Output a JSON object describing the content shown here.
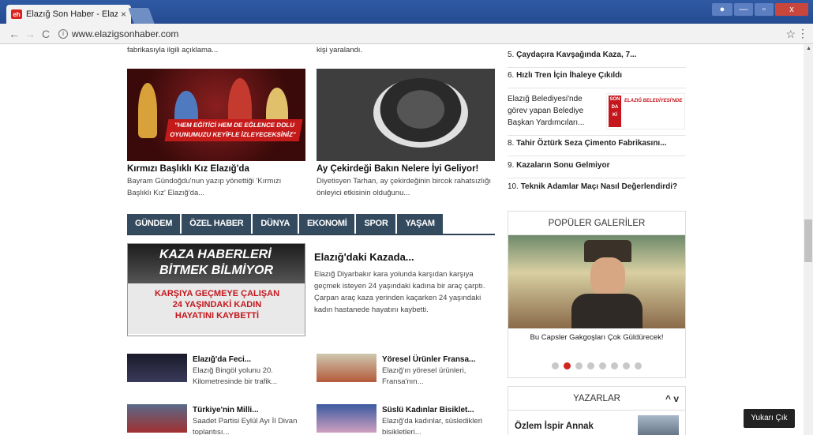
{
  "browser": {
    "tab_title": "Elazığ Son Haber - Elazı",
    "favicon": "eh",
    "url": "www.elazigsonhaber.com",
    "back_icon": "←",
    "forward_icon": "→",
    "reload_icon": "C",
    "star_icon": "☆",
    "menu_icon": "⋮",
    "close_tab": "×",
    "win_close": "x",
    "win_min": "—",
    "win_max": "▫"
  },
  "top_snippets": {
    "left": "fabrikasıyla ilgili açıklama...",
    "mid": "kişi yaralandı."
  },
  "featured": [
    {
      "title": "Kırmızı Başlıklı Kız Elazığ'da",
      "desc": "Bayram Gündoğdu'nun yazıp yönettiği 'Kırmızı Başlıklı Kız' Elazığ'da...",
      "image_text": "\"HEM EĞİTİCİ HEM DE EĞLENCE DOLU OYUNUMUZU KEYİFLE İZLEYECEKSİNİZ\""
    },
    {
      "title": "Ay Çekirdeği Bakın Nelere İyi Geliyor!",
      "desc": "Diyetisyen Tarhan, ay çekirdeğinin bircok rahatsızlığı önleyici etkisinin olduğunu..."
    }
  ],
  "categories": [
    "GÜNDEM",
    "ÖZEL HABER",
    "DÜNYA",
    "EKONOMİ",
    "SPOR",
    "YAŞAM"
  ],
  "main_story": {
    "img_line1": "KAZA HABERLERİ",
    "img_line2": "BİTMEK BİLMİYOR",
    "img_line3": "KARŞIYA GEÇMEYE ÇALIŞAN",
    "img_line4": "24 YAŞINDAKİ KADIN",
    "img_line5": "HAYATINI KAYBETTİ",
    "title": "Elazığ'daki Kazada...",
    "desc": "Elazığ Diyarbakır kara yolunda karşıdan karşıya geçmek isteyen 24 yaşındaki kadına bir araç çarptı. Çarpan araç kaza yerinden kaçarken 24 yaşındaki kadın hastanede hayatını kaybetti."
  },
  "small_news": [
    {
      "title": "Elazığ'da Feci...",
      "desc": "Elazığ Bingöl yolunu 20. Kilometresinde bir trafik..."
    },
    {
      "title": "Yöresel Ürünler Fransa...",
      "desc": "Elazığ'ın yöresel ürünleri, Fransa'nın..."
    },
    {
      "title": "Türkiye'nin Milli...",
      "desc": "Saadet Partisi Eylül Ayı İl Divan toplantısı..."
    },
    {
      "title": "Süslü Kadınlar Bisiklet...",
      "desc": "Elazığ'da kadınlar, süsledikleri bisikletleri..."
    }
  ],
  "most_read": [
    {
      "num": "5.",
      "title": "Çaydaçıra Kavşağında Kaza, 7..."
    },
    {
      "num": "6.",
      "title": "Hızlı Tren İçin İhaleye Çıkıldı"
    },
    {
      "num": "",
      "title": "Elazığ Belediyesi'nde görev yapan Belediye Başkan Yardımcıları..."
    },
    {
      "num": "8.",
      "title": "Tahir Öztürk Seza Çimento Fabrikasını..."
    },
    {
      "num": "9.",
      "title": "Kazaların Sonu Gelmiyor"
    },
    {
      "num": "10.",
      "title": "Teknik Adamlar Maçı Nasıl Değerlendirdi?"
    }
  ],
  "ad_thumb": {
    "line1": "ELAZIĞ BELEDİYESİ'NDE",
    "badge": "SON DA Kİ"
  },
  "gallery": {
    "heading": "POPÜLER GALERİLER",
    "caption": "Bu Capsler Gakgoşları Çok Güldürecek!",
    "dot_count": 8,
    "active_dot": 1
  },
  "yazarlar": {
    "heading": "YAZARLAR",
    "arrows": "^ v",
    "name": "Özlem İspir Annak"
  },
  "scroll_top": "Yukarı Çık",
  "colors": {
    "nav_bar": "#344b5f",
    "accent_red": "#d0261e",
    "title_bar": "#2f5aa3"
  }
}
